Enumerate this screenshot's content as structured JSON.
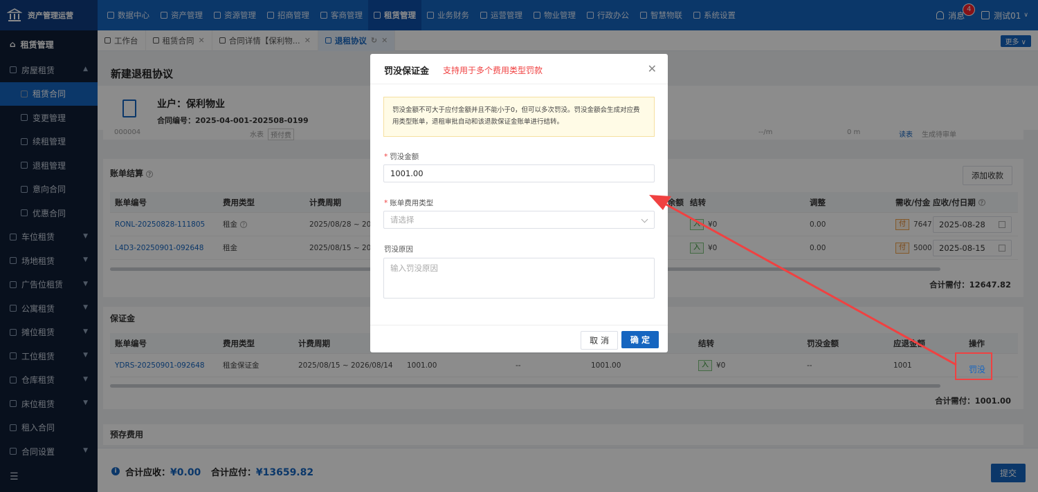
{
  "brand": {
    "title": "资产管理运营"
  },
  "nav": [
    {
      "label": "数据中心",
      "active": false
    },
    {
      "label": "资产管理",
      "active": false
    },
    {
      "label": "资源管理",
      "active": false
    },
    {
      "label": "招商管理",
      "active": false
    },
    {
      "label": "客商管理",
      "active": false
    },
    {
      "label": "租赁管理",
      "active": true
    },
    {
      "label": "业务财务",
      "active": false
    },
    {
      "label": "运营管理",
      "active": false
    },
    {
      "label": "物业管理",
      "active": false
    },
    {
      "label": "行政办公",
      "active": false
    },
    {
      "label": "智慧物联",
      "active": false
    },
    {
      "label": "系统设置",
      "active": false
    }
  ],
  "topright": {
    "messages_label": "消息",
    "messages_count": "4",
    "user": "测试01"
  },
  "sidebar": {
    "header": "租赁管理",
    "items": [
      {
        "label": "房屋租赁",
        "level": 0,
        "chev": "▲"
      },
      {
        "label": "租赁合同",
        "level": 1,
        "active": true
      },
      {
        "label": "变更管理",
        "level": 1
      },
      {
        "label": "续租管理",
        "level": 1
      },
      {
        "label": "退租管理",
        "level": 1
      },
      {
        "label": "意向合同",
        "level": 1
      },
      {
        "label": "优惠合同",
        "level": 1
      },
      {
        "label": "车位租赁",
        "level": 0,
        "chev": "▼"
      },
      {
        "label": "场地租赁",
        "level": 0,
        "chev": "▼"
      },
      {
        "label": "广告位租赁",
        "level": 0,
        "chev": "▼"
      },
      {
        "label": "公寓租赁",
        "level": 0,
        "chev": "▼"
      },
      {
        "label": "摊位租赁",
        "level": 0,
        "chev": "▼"
      },
      {
        "label": "工位租赁",
        "level": 0,
        "chev": "▼"
      },
      {
        "label": "仓库租赁",
        "level": 0,
        "chev": "▼"
      },
      {
        "label": "床位租赁",
        "level": 0,
        "chev": "▼"
      },
      {
        "label": "租入合同",
        "level": 0,
        "chev": ""
      },
      {
        "label": "合同设置",
        "level": 0,
        "chev": "▼"
      }
    ]
  },
  "tabs": [
    {
      "label": "工作台",
      "closable": false,
      "active": false
    },
    {
      "label": "租赁合同",
      "closable": true,
      "active": false
    },
    {
      "label": "合同详情【保利物...",
      "closable": true,
      "active": false
    },
    {
      "label": "退租协议",
      "closable": true,
      "active": true
    }
  ],
  "more_label": "更多",
  "page": {
    "title": "新建退租协议",
    "owner": "业户：保利物业",
    "contract_no": "合同编号：2025-04-001-202508-0199",
    "partial_row": {
      "c1": "000004",
      "c2": "水表",
      "c3": "预付费",
      "c4": "--/m",
      "c5": "0 m",
      "c6": "读表",
      "c7": "生成待审单"
    }
  },
  "billing": {
    "title": "账单结算",
    "add_label": "添加收款",
    "headers": [
      "账单编号",
      "费用类型",
      "计费周期",
      "余额",
      "结转",
      "调整",
      "需收/付金",
      "应收/付日期"
    ],
    "rows": [
      {
        "no": "RONL-20250828-111805",
        "type": "租金",
        "period": "2025/08/28 ~ 2025/0",
        "carry_tag": "入",
        "carry": "¥0",
        "adjust": "0.00",
        "pay_tag": "付",
        "amount": "7647",
        "date": "2025-08-28"
      },
      {
        "no": "L4D3-20250901-092648",
        "type": "租金",
        "period": "2025/08/15 ~ 2025/0",
        "carry_tag": "入",
        "carry": "¥0",
        "adjust": "0.00",
        "pay_tag": "付",
        "amount": "5000",
        "date": "2025-08-15"
      }
    ],
    "total": "合计需付：12647.82"
  },
  "deposit": {
    "title": "保证金",
    "headers": [
      "账单编号",
      "费用类型",
      "计费周期",
      "结转",
      "罚没金额",
      "应退金额",
      "操作"
    ],
    "row": {
      "no": "YDRS-20250901-092648",
      "type": "租金保证金",
      "period": "2025/08/15 ~ 2026/08/14",
      "amt1": "1001.00",
      "amt2": "--",
      "amt3": "1001.00",
      "carry_tag": "入",
      "carry": "¥0",
      "forfeit": "--",
      "refund": "1001",
      "action": "罚没"
    },
    "total": "合计需付：1001.00"
  },
  "prestore": {
    "title": "预存费用"
  },
  "footer": {
    "recv_label": "合计应收：",
    "recv": "¥0.00",
    "pay_label": "合计应付：",
    "pay": "¥13659.82",
    "submit": "提交"
  },
  "modal": {
    "title": "罚没保证金",
    "subtitle": "支持用于多个费用类型罚款",
    "alert": "罚没金额不可大于应付金额并且不能小于0，但可以多次罚没。罚没金额会生成对应费用类型账单，退租审批自动和该退款保证金账单进行结转。",
    "amount_label": "罚没金额",
    "amount_value": "1001.00",
    "type_label": "账单费用类型",
    "type_placeholder": "请选择",
    "reason_label": "罚没原因",
    "reason_placeholder": "输入罚没原因",
    "cancel": "取 消",
    "ok": "确 定"
  }
}
